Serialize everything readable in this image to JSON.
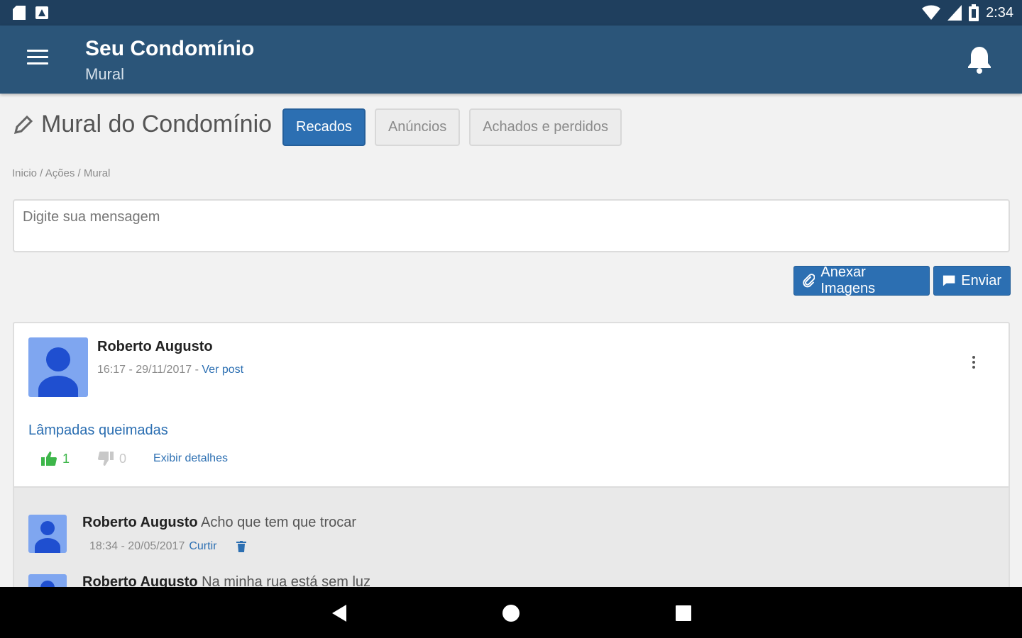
{
  "status_bar": {
    "time": "2:34"
  },
  "app_bar": {
    "title": "Seu Condomínio",
    "subtitle": "Mural"
  },
  "page": {
    "title": "Mural do Condomínio",
    "tabs": [
      {
        "label": "Recados",
        "active": true
      },
      {
        "label": "Anúncios",
        "active": false
      },
      {
        "label": "Achados e perdidos",
        "active": false
      }
    ],
    "breadcrumb": "Inicio / Ações / Mural"
  },
  "composer": {
    "placeholder": "Digite sua mensagem",
    "attach_label": "Anexar Imagens",
    "send_label": "Enviar"
  },
  "post": {
    "author": "Roberto Augusto",
    "timestamp": "16:17 - 29/11/2017 - ",
    "view_post_label": "Ver post",
    "title": "Lâmpadas queimadas",
    "likes": "1",
    "dislikes": "0",
    "details_label": "Exibir detalhes",
    "comments": [
      {
        "author": "Roberto Augusto",
        "text": "Acho que tem que trocar",
        "timestamp": "18:34 - 20/05/2017",
        "like_label": "Curtir"
      },
      {
        "author": "Roberto Augusto",
        "text": "Na minha rua está sem luz"
      }
    ]
  },
  "colors": {
    "status_bar": "#1f3f5e",
    "app_bar": "#2b5579",
    "primary": "#2c6fb2",
    "like_green": "#3db64a",
    "avatar_bg": "#7fa6f0",
    "avatar_fg": "#1f4fd0"
  },
  "icons": {
    "menu": "hamburger-menu-icon",
    "bell": "notification-bell-icon",
    "pencil": "pencil-icon",
    "paperclip": "paperclip-icon",
    "chat": "chat-icon",
    "kebab": "more-vertical-icon",
    "thumbs_up": "thumbs-up-icon",
    "thumbs_down": "thumbs-down-icon",
    "trash": "trash-icon",
    "back": "back-triangle-icon",
    "home": "home-circle-icon",
    "recents": "recents-square-icon"
  }
}
